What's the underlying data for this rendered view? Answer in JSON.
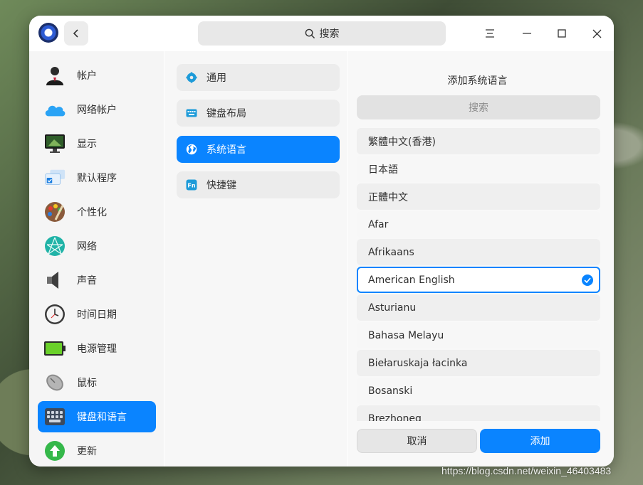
{
  "titlebar": {
    "search_label": "搜索"
  },
  "sidebar": {
    "items": [
      {
        "label": "帐户",
        "icon": "account-icon"
      },
      {
        "label": "网络帐户",
        "icon": "cloud-icon"
      },
      {
        "label": "显示",
        "icon": "display-icon"
      },
      {
        "label": "默认程序",
        "icon": "default-apps-icon"
      },
      {
        "label": "个性化",
        "icon": "palette-icon"
      },
      {
        "label": "网络",
        "icon": "network-icon"
      },
      {
        "label": "声音",
        "icon": "speaker-icon"
      },
      {
        "label": "时间日期",
        "icon": "clock-icon"
      },
      {
        "label": "电源管理",
        "icon": "battery-icon"
      },
      {
        "label": "鼠标",
        "icon": "mouse-icon"
      },
      {
        "label": "键盘和语言",
        "icon": "keyboard-icon",
        "active": true
      },
      {
        "label": "更新",
        "icon": "update-icon"
      }
    ]
  },
  "subnav": {
    "items": [
      {
        "label": "通用",
        "icon": "gear-icon"
      },
      {
        "label": "键盘布局",
        "icon": "keyboard-layout-icon"
      },
      {
        "label": "系统语言",
        "icon": "globe-icon",
        "active": true
      },
      {
        "label": "快捷键",
        "icon": "fn-key-icon"
      }
    ]
  },
  "language_panel": {
    "title": "添加系统语言",
    "search_placeholder": "搜索",
    "languages": [
      "繁體中文(香港)",
      "日本語",
      "正體中文",
      "Afar",
      "Afrikaans",
      "American English",
      "Asturianu",
      "Bahasa Melayu",
      "Biełaruskaja łacinka",
      "Bosanski",
      "Brezhoneg"
    ],
    "selected": "American English",
    "cancel_label": "取消",
    "add_label": "添加"
  },
  "watermark": "https://blog.csdn.net/weixin_46403483",
  "colors": {
    "accent": "#0a84ff"
  }
}
